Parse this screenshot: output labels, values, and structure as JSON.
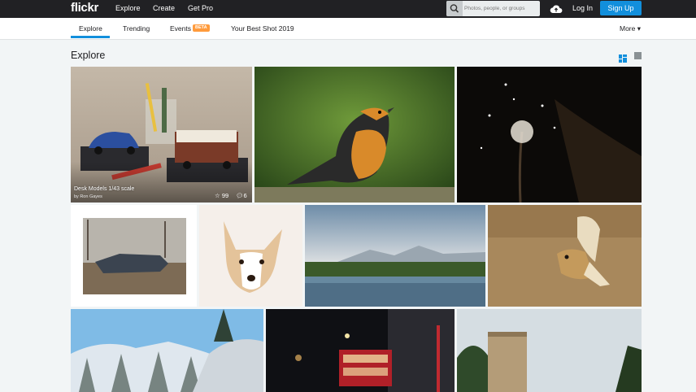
{
  "topbar": {
    "logo": "flickr",
    "nav": [
      "Explore",
      "Create",
      "Get Pro"
    ],
    "search_placeholder": "Photos, people, or groups",
    "login": "Log In",
    "signup": "Sign Up"
  },
  "subnav": {
    "tabs": [
      "Explore",
      "Trending",
      "Events",
      "Your Best Shot 2019"
    ],
    "beta": "BETA",
    "more": "More ▾"
  },
  "page": {
    "title": "Explore"
  },
  "featured": {
    "title": "Desk Models 1/43 scale",
    "author": "by Ron Gayes",
    "faves": "99",
    "comments": "6"
  },
  "colors": {
    "accent": "#128fdc",
    "topbar": "#212124",
    "beta": "#ff9b3c"
  },
  "icons": [
    "search-icon",
    "upload-cloud-icon",
    "star-icon",
    "comment-icon",
    "justified-view-icon",
    "single-view-icon"
  ]
}
